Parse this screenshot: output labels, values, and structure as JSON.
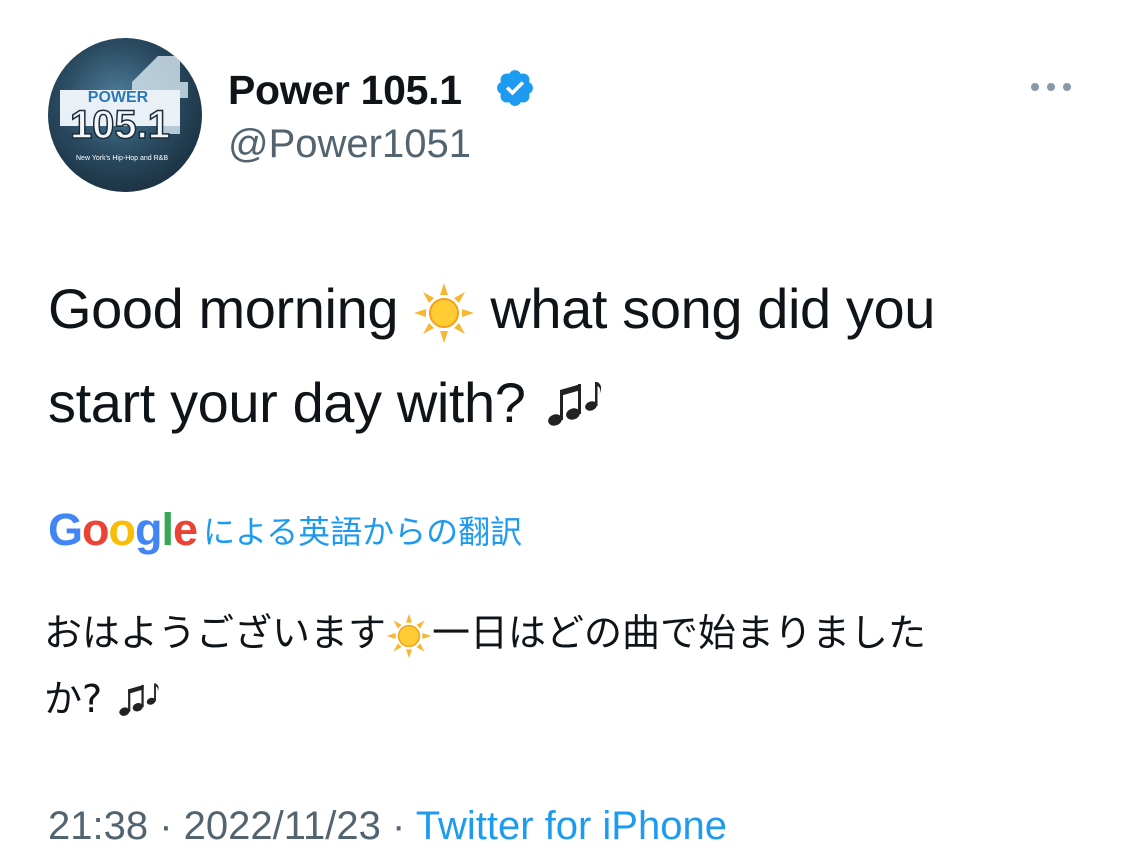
{
  "author": {
    "display_name": "Power 105.1",
    "handle": "@Power1051",
    "verified_icon": "verified-badge-icon",
    "avatar": {
      "logo_top": "POWER",
      "logo_number": "105.1",
      "tagline": "New York's Hip-Hop and R&B"
    }
  },
  "more_icon": "more-horizontal-icon",
  "tweet": {
    "line1_before": "Good morning ",
    "line1_after": " what song did you",
    "line2": "start your day with? ",
    "emoji_sun": "sun-emoji-icon",
    "emoji_music": "music-notes-emoji-icon"
  },
  "translation": {
    "provider": "Google",
    "provider_letters": [
      "G",
      "o",
      "o",
      "g",
      "l",
      "e"
    ],
    "provider_colors": [
      "#4285F4",
      "#EA4335",
      "#FBBC05",
      "#4285F4",
      "#34A853",
      "#EA4335"
    ],
    "label": "による英語からの翻訳",
    "line1_before": "おはようございます",
    "line1_after": "一日はどの曲で始まりました",
    "line2": "か? "
  },
  "meta": {
    "time": "21:38",
    "separator": " · ",
    "date": "2022/11/23",
    "source": "Twitter for iPhone"
  },
  "colors": {
    "accent": "#1d9bf0",
    "secondary_text": "#536471",
    "primary_text": "#0f1419"
  }
}
